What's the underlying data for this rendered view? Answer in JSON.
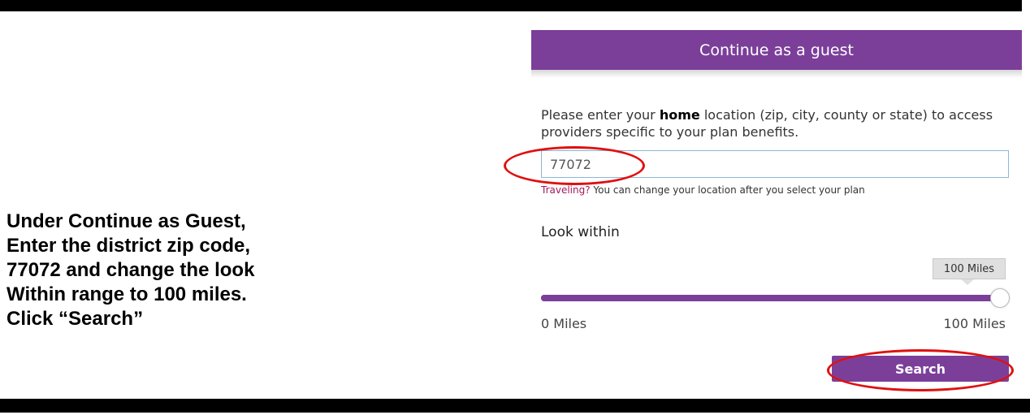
{
  "instructions": {
    "lines": [
      "Under Continue as Guest,",
      "Enter the district zip code,",
      "77072 and change the look",
      "Within range to 100 miles.",
      "Click “Search”"
    ]
  },
  "panel": {
    "title": "Continue as a guest",
    "prompt_before": "Please enter your ",
    "prompt_bold": "home",
    "prompt_after": " location (zip, city, county or state) to access providers specific to your plan benefits."
  },
  "location_input": {
    "value": "77072"
  },
  "travel_note": {
    "link": "Traveling?",
    "text": " You can change your location after you select your plan"
  },
  "range": {
    "label": "Look within",
    "value": 100,
    "value_label": "100 Miles",
    "min": 0,
    "max": 100,
    "min_label": "0 Miles",
    "max_label": "100 Miles"
  },
  "search_button": {
    "label": "Search"
  },
  "colors": {
    "brand_purple": "#7b3f9a",
    "link": "#a3195b",
    "highlight": "#e01010"
  }
}
